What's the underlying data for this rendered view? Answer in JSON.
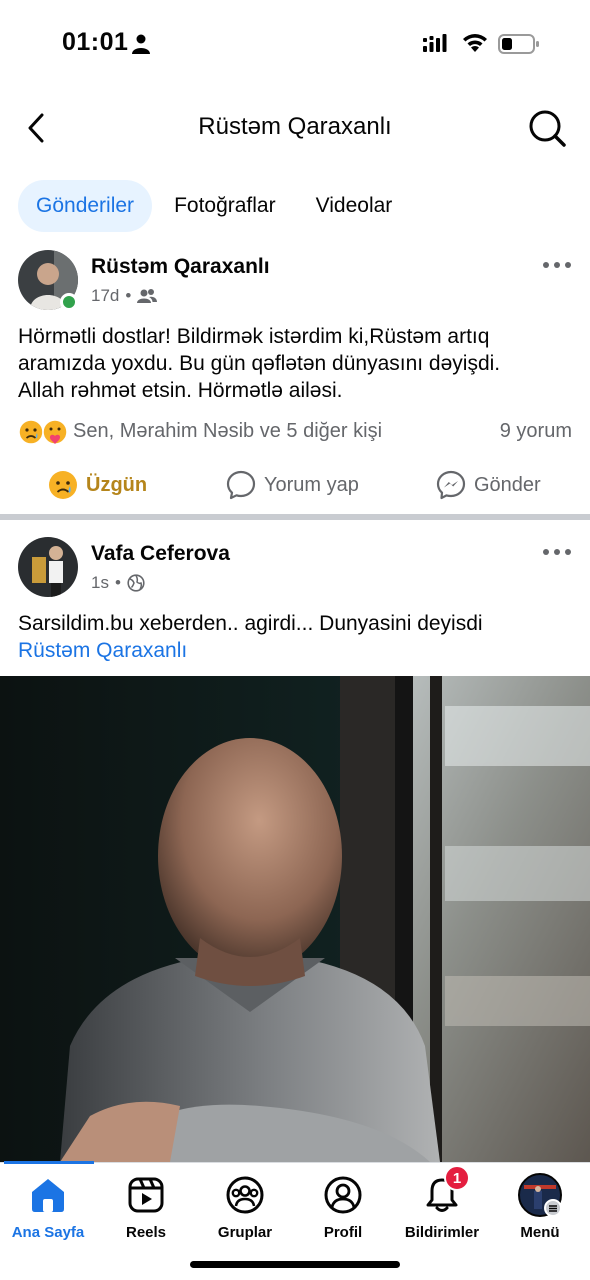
{
  "status_bar": {
    "time": "01:01"
  },
  "top_bar": {
    "title": "Rüstəm Qaraxanlı"
  },
  "tabs": [
    {
      "label": "Gönderiler",
      "active": true
    },
    {
      "label": "Fotoğraflar",
      "active": false
    },
    {
      "label": "Videolar",
      "active": false
    }
  ],
  "posts": [
    {
      "author": "Rüstəm Qaraxanlı",
      "time": "17d",
      "audience_icon": "friends-icon",
      "online": true,
      "text_lines": [
        "Hörmətli dostlar! Bildirmək istərdim ki,Rüstəm artıq",
        "aramızda yoxdu. Bu gün qəflətən dünyasını dəyişdi.",
        "Allah rəhmət etsin. Hörmətlə ailəsi."
      ],
      "reactions_text": "Sen, Mərahim Nəsib ve 5 diğer kişi",
      "comments_text": "9 yorum",
      "actions": {
        "react": "Üzgün",
        "comment": "Yorum yap",
        "share": "Gönder"
      }
    },
    {
      "author": "Vafa Ceferova",
      "time": "1s",
      "audience_icon": "globe-icon",
      "text": "Sarsildim.bu xeberden.. agirdi... Dunyasini deyisdi",
      "mention": "Rüstəm Qaraxanlı"
    }
  ],
  "bottom_nav": [
    {
      "label": "Ana Sayfa",
      "icon": "home-icon",
      "active": true
    },
    {
      "label": "Reels",
      "icon": "reels-icon",
      "active": false
    },
    {
      "label": "Gruplar",
      "icon": "groups-icon",
      "active": false
    },
    {
      "label": "Profil",
      "icon": "profile-icon",
      "active": false
    },
    {
      "label": "Bildirimler",
      "icon": "bell-icon",
      "active": false,
      "badge": "1"
    },
    {
      "label": "Menü",
      "icon": "menu-avatar-icon",
      "active": false
    }
  ],
  "colors": {
    "accent": "#1b74e4",
    "tab_active_bg": "#e7f3ff",
    "online": "#31a24c",
    "sad_reaction_text": "#b5851b",
    "badge": "#e41e3f",
    "secondary_text": "#65676b"
  }
}
